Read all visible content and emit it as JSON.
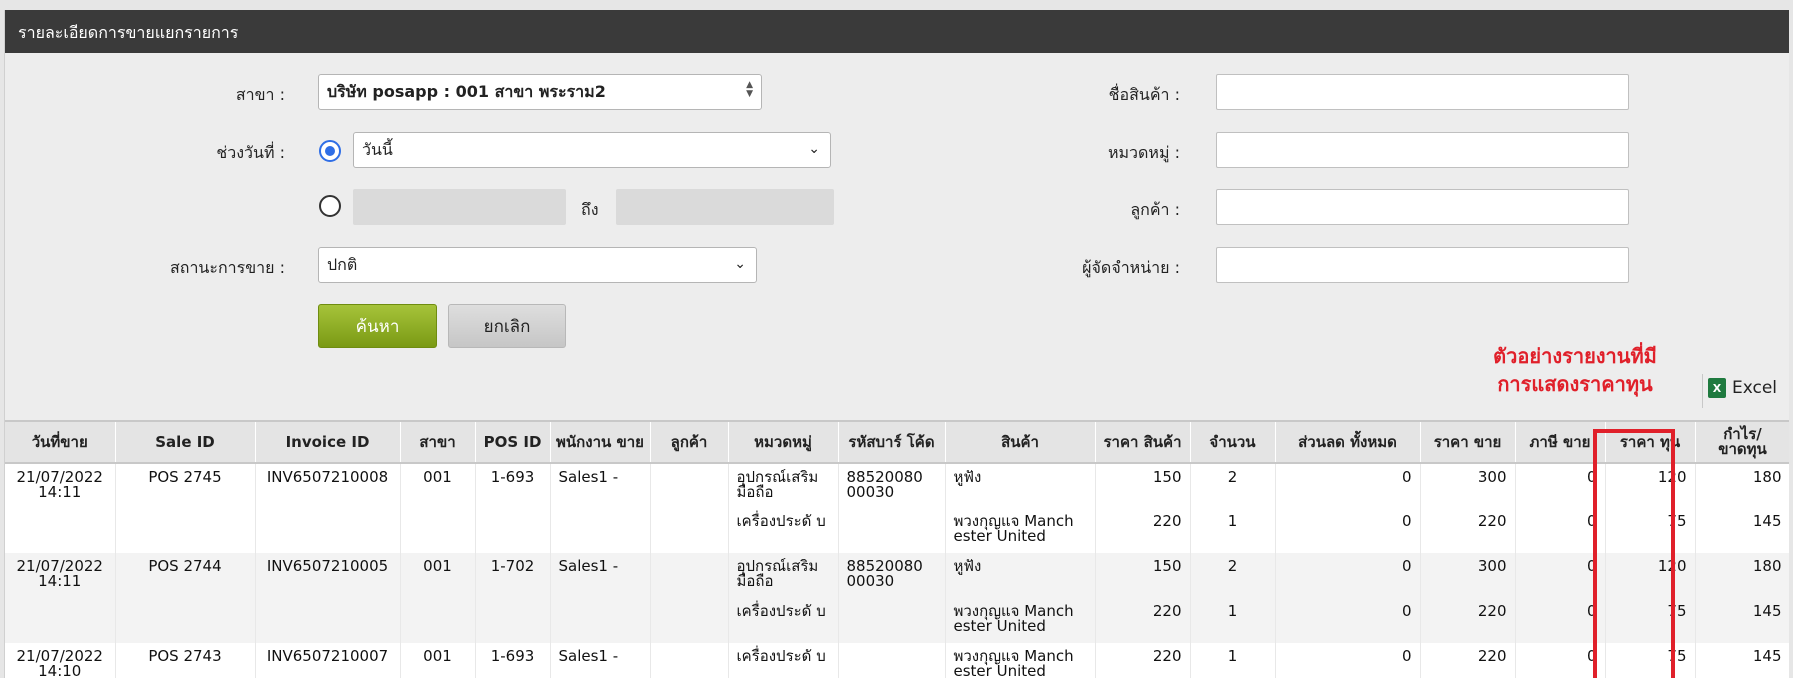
{
  "title": "รายละเอียดการขายแยกรายการ",
  "form": {
    "branch_label": "สาขา :",
    "branch_value": "บริษัท posapp : 001 สาขา พระราม2",
    "date_range_label": "ช่วงวันที่ :",
    "date_option_value": "วันนี้",
    "to_label": "ถึง",
    "sale_status_label": "สถานะการขาย :",
    "sale_status_value": "ปกติ",
    "product_name_label": "ชื่อสินค้า :",
    "category_label": "หมวดหมู่ :",
    "customer_label": "ลูกค้า :",
    "supplier_label": "ผู้จัดจำหน่าย :",
    "search_button": "ค้นหา",
    "cancel_button": "ยกเลิก"
  },
  "annotation": {
    "line1": "ตัวอย่างรายงานที่มี",
    "line2": "การแสดงราคาทุน",
    "color": "#e0202a"
  },
  "export": {
    "excel_label": "Excel",
    "icon": "excel-icon"
  },
  "table": {
    "headers": [
      "วันที่ขาย",
      "Sale ID",
      "Invoice ID",
      "สาขา",
      "POS ID",
      "พนักงาน ขาย",
      "ลูกค้า",
      "หมวดหมู่",
      "รหัสบาร์ โค้ด",
      "สินค้า",
      "ราคา สินค้า",
      "จำนวน",
      "ส่วนลด ทั้งหมด",
      "ราคา ขาย",
      "ภาษี ขาย",
      "ราคา ทุน",
      "กำไร/ ขาดทุน"
    ],
    "rows": [
      [
        "21/07/2022 14:11",
        "POS 2745",
        "INV6507210008",
        "001",
        "1-693",
        "Sales1 -",
        "",
        "อุปกรณ์เสริม มือถือ",
        "88520080 00030",
        "หูฟัง",
        "150",
        "2",
        "0",
        "300",
        "0",
        "120",
        "180"
      ],
      [
        "",
        "",
        "",
        "",
        "",
        "",
        "",
        "เครื่องประดั บ",
        "",
        "พวงกุญแจ Manch ester United",
        "220",
        "1",
        "0",
        "220",
        "0",
        "75",
        "145"
      ],
      [
        "21/07/2022 14:11",
        "POS 2744",
        "INV6507210005",
        "001",
        "1-702",
        "Sales1 -",
        "",
        "อุปกรณ์เสริม มือถือ",
        "88520080 00030",
        "หูฟัง",
        "150",
        "2",
        "0",
        "300",
        "0",
        "120",
        "180"
      ],
      [
        "",
        "",
        "",
        "",
        "",
        "",
        "",
        "เครื่องประดั บ",
        "",
        "พวงกุญแจ Manch ester United",
        "220",
        "1",
        "0",
        "220",
        "0",
        "75",
        "145"
      ],
      [
        "21/07/2022 14:10",
        "POS 2743",
        "INV6507210007",
        "001",
        "1-693",
        "Sales1 -",
        "",
        "เครื่องประดั บ",
        "",
        "พวงกุญแจ Manch ester United",
        "220",
        "1",
        "0",
        "220",
        "0",
        "75",
        "145"
      ]
    ]
  }
}
